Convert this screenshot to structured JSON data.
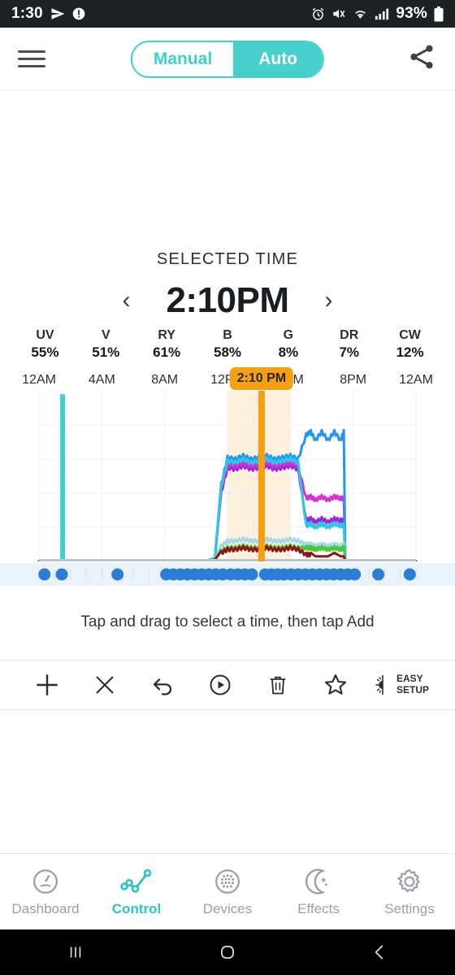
{
  "statusbar": {
    "time": "1:30",
    "battery_percent": "93%",
    "icons": [
      "send-icon",
      "alert-icon",
      "alarm-icon",
      "mute-icon",
      "wifi-icon",
      "signal-icon",
      "battery-icon"
    ]
  },
  "appbar": {
    "menu_icon": "hamburger-icon",
    "share_icon": "share-icon",
    "modes": [
      {
        "label": "Manual",
        "active": false
      },
      {
        "label": "Auto",
        "active": true
      }
    ],
    "accent": "#46cfcb"
  },
  "selected": {
    "title": "SELECTED TIME",
    "time": "2:10PM",
    "prev_label": "‹",
    "next_label": "›",
    "channels": [
      {
        "name": "UV",
        "value": "55%"
      },
      {
        "name": "V",
        "value": "51%"
      },
      {
        "name": "RY",
        "value": "61%"
      },
      {
        "name": "B",
        "value": "58%"
      },
      {
        "name": "G",
        "value": "8%"
      },
      {
        "name": "DR",
        "value": "7%"
      },
      {
        "name": "CW",
        "value": "12%"
      }
    ]
  },
  "chart_data": {
    "type": "line",
    "title": "",
    "xlabel": "",
    "ylabel": "",
    "xlim": [
      0,
      24
    ],
    "ylim": [
      0,
      100
    ],
    "grid": true,
    "legend_position": "none",
    "tick_labels": [
      "12AM",
      "4AM",
      "8AM",
      "12PM",
      "4PM",
      "8PM",
      "12AM"
    ],
    "tick_hours": [
      0,
      4,
      8,
      12,
      16,
      20,
      24
    ],
    "marker": {
      "label": "2:10 PM",
      "hour": 14.1667,
      "color": "#f5a013",
      "band_start_hour": 12.0,
      "band_end_hour": 16.0,
      "band_color": "#fdf0dc"
    },
    "x": [
      0,
      1.3,
      1.35,
      1.4,
      1.45,
      5,
      9,
      10.5,
      11.2,
      11.6,
      12,
      12.5,
      13,
      13.5,
      14,
      14.5,
      15,
      15.5,
      16,
      16.5,
      17,
      17.3,
      17.6,
      18,
      18.4,
      18.8,
      19.2,
      19.4,
      19.5,
      20,
      24
    ],
    "series": [
      {
        "name": "UV",
        "color": "#9c27e0",
        "values": [
          0,
          0,
          0,
          0,
          0,
          0,
          0,
          0,
          2,
          40,
          55,
          54,
          56,
          54,
          55,
          56,
          54,
          55,
          56,
          54,
          24,
          25,
          23,
          25,
          23,
          25,
          24,
          24,
          0,
          0,
          0
        ]
      },
      {
        "name": "V",
        "color": "#d92fd0",
        "values": [
          0,
          0,
          0,
          0,
          0,
          0,
          0,
          0,
          2,
          42,
          57,
          56,
          58,
          56,
          57,
          58,
          56,
          57,
          58,
          56,
          37,
          38,
          36,
          38,
          36,
          38,
          37,
          37,
          0,
          0,
          0
        ]
      },
      {
        "name": "RY",
        "color": "#2196f3",
        "values": [
          0,
          0,
          0,
          0,
          0,
          0,
          0,
          0,
          2,
          45,
          61,
          60,
          62,
          60,
          61,
          62,
          60,
          61,
          62,
          60,
          74,
          76,
          71,
          76,
          71,
          76,
          71,
          76,
          0,
          0,
          0
        ]
      },
      {
        "name": "B",
        "color": "#29c7e8",
        "values": [
          0,
          0,
          0,
          0,
          0,
          0,
          0,
          0,
          2,
          44,
          59,
          58,
          60,
          58,
          59,
          60,
          58,
          59,
          60,
          58,
          21,
          22,
          20,
          22,
          20,
          22,
          21,
          21,
          0,
          0,
          0
        ]
      },
      {
        "name": "CW-spike",
        "color": "#3fd0cd",
        "values": [
          0,
          0,
          98,
          98,
          0,
          0,
          0,
          0,
          0,
          0,
          0,
          0,
          0,
          0,
          0,
          0,
          0,
          0,
          0,
          0,
          0,
          0,
          0,
          0,
          0,
          0,
          0,
          0,
          0,
          0,
          0
        ]
      },
      {
        "name": "CW",
        "color": "#a5d8e8",
        "values": [
          0,
          0,
          0,
          0,
          0,
          0,
          0,
          0,
          1,
          9,
          12,
          12,
          13,
          12,
          12,
          13,
          12,
          12,
          13,
          12,
          10,
          10,
          9,
          10,
          9,
          10,
          9,
          10,
          0,
          0,
          0
        ]
      },
      {
        "name": "G",
        "color": "#49c832",
        "values": [
          0,
          0,
          0,
          0,
          0,
          0,
          0,
          0,
          1,
          6,
          8,
          8,
          9,
          8,
          8,
          9,
          8,
          8,
          9,
          8,
          8,
          8,
          7,
          8,
          7,
          8,
          7,
          8,
          0,
          0,
          0
        ]
      },
      {
        "name": "DR",
        "color": "#8e1515",
        "values": [
          0,
          0,
          0,
          0,
          0,
          0,
          0,
          0,
          1,
          5,
          7,
          7,
          8,
          7,
          7,
          8,
          7,
          7,
          8,
          7,
          4,
          4,
          3,
          4,
          3,
          4,
          3,
          4,
          0,
          0,
          0
        ]
      }
    ],
    "schedule_points_hours": [
      0.35,
      1.45,
      5.0,
      8.1,
      8.55,
      9.0,
      9.45,
      9.9,
      10.35,
      10.8,
      11.25,
      11.7,
      12.2,
      12.65,
      13.1,
      13.55,
      14.4,
      14.8,
      15.2,
      15.6,
      16.05,
      16.5,
      16.95,
      17.4,
      17.85,
      18.3,
      18.75,
      19.2,
      19.65,
      20.1,
      21.6,
      23.6
    ]
  },
  "hint": "Tap and drag to select a time, then tap Add",
  "toolbar": [
    {
      "icon": "plus-icon",
      "label": ""
    },
    {
      "icon": "close-icon",
      "label": ""
    },
    {
      "icon": "undo-icon",
      "label": ""
    },
    {
      "icon": "play-circle-icon",
      "label": ""
    },
    {
      "icon": "trash-icon",
      "label": ""
    },
    {
      "icon": "star-icon",
      "label": ""
    },
    {
      "icon": "easy-setup-icon",
      "label": "EASY\nSETUP",
      "line1": "EASY",
      "line2": "SETUP"
    }
  ],
  "bottomnav": {
    "active_color": "#2cc6c2",
    "inactive_color": "#9aa0a6",
    "items": [
      {
        "label": "Dashboard",
        "icon": "gauge-icon",
        "active": false
      },
      {
        "label": "Control",
        "icon": "graph-icon",
        "active": true
      },
      {
        "label": "Devices",
        "icon": "devices-icon",
        "active": false
      },
      {
        "label": "Effects",
        "icon": "moon-icon",
        "active": false
      },
      {
        "label": "Settings",
        "icon": "gear-icon",
        "active": false
      }
    ]
  },
  "androidnav": {
    "items": [
      {
        "icon": "recents-icon"
      },
      {
        "icon": "home-icon"
      },
      {
        "icon": "back-icon"
      }
    ]
  }
}
